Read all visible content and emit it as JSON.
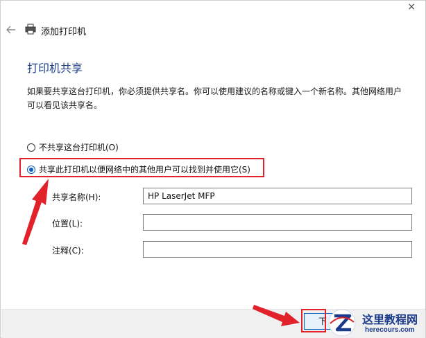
{
  "window": {
    "title": "添加打印机",
    "close_glyph": "×",
    "back_glyph": "←"
  },
  "page": {
    "heading": "打印机共享",
    "description": "如果要共享这台打印机，你必须提供共享名。你可以使用建议的名称或键入一个新名称。其他网络用户可以看见该共享名。"
  },
  "options": {
    "no_share": {
      "label": "不共享这台打印机(O)",
      "checked": false
    },
    "share": {
      "label": "共享此打印机以便网络中的其他用户可以找到并使用它(S)",
      "checked": true
    }
  },
  "fields": {
    "share_name": {
      "label": "共享名称(H):",
      "value": "HP LaserJet MFP"
    },
    "location": {
      "label": "位置(L):",
      "value": ""
    },
    "comment": {
      "label": "注释(C):",
      "value": ""
    }
  },
  "footer": {
    "next_label": "下"
  },
  "watermark": {
    "name": "这里教程网",
    "url": "herecours.com"
  },
  "colors": {
    "heading": "#1e3f8a",
    "annotation": "#e2222b",
    "accent": "#0a5fc1"
  }
}
